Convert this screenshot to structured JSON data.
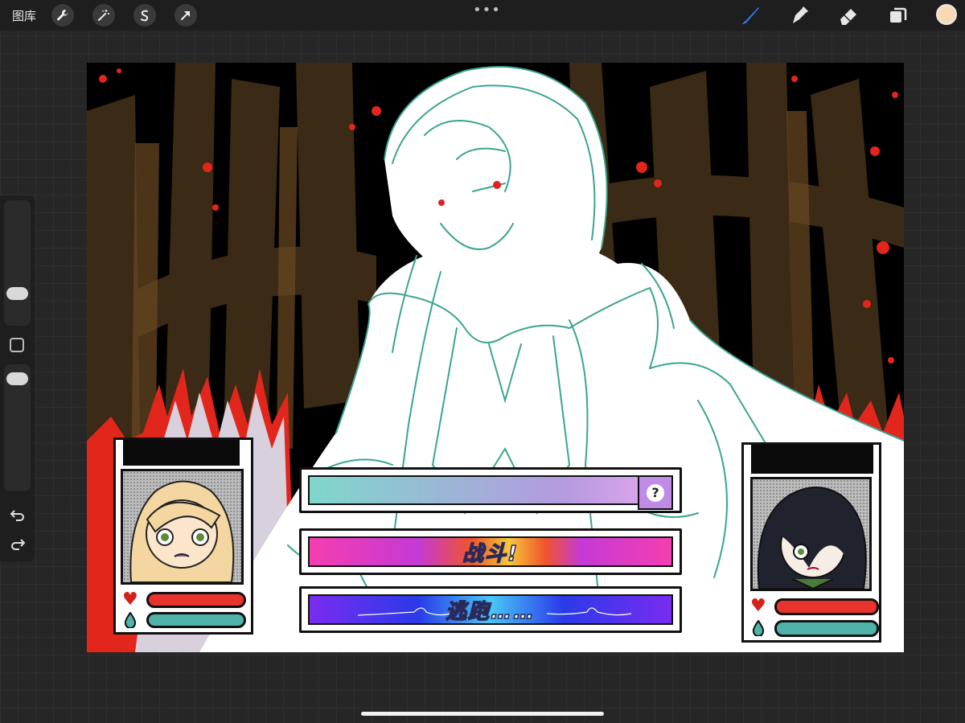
{
  "toolbar": {
    "gallery_label": "图库",
    "left_tools": [
      "wrench-icon",
      "magic-wand-icon",
      "selection-icon",
      "transform-arrow-icon"
    ],
    "more_label": "•••",
    "right_tools": [
      "brush-icon",
      "smudge-icon",
      "eraser-icon",
      "layers-icon"
    ],
    "active_tool": "brush-icon",
    "current_color": "#f9d9b4"
  },
  "sidebar": {
    "items": [
      "brush-size-slider",
      "modify-button",
      "opacity-slider",
      "undo-icon",
      "redo-icon"
    ]
  },
  "game_ui": {
    "question_mark": "?",
    "fight_label": "战斗!",
    "flee_label": "逃跑……",
    "accent_colors": {
      "hp": "#e8332e",
      "mp": "#4fb3a9",
      "sketch": "#3aa590"
    }
  }
}
